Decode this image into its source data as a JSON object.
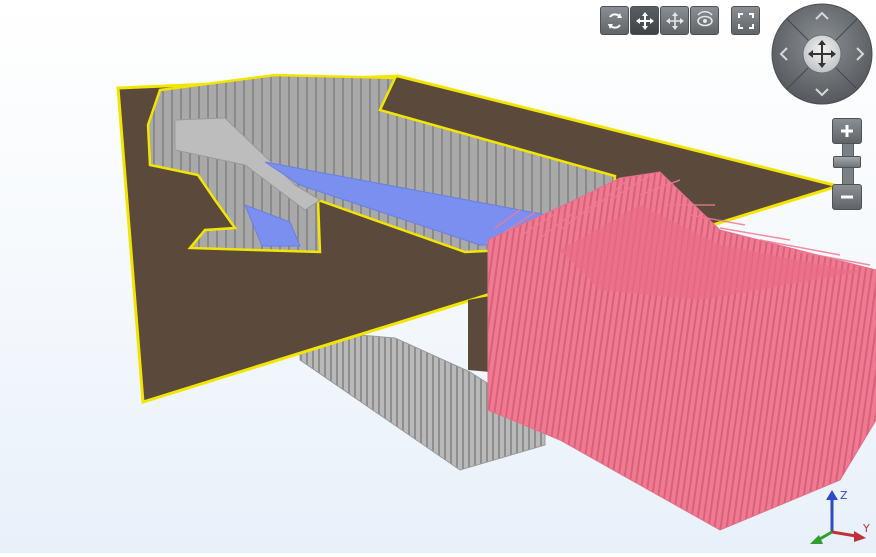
{
  "toolbar": {
    "buttons": [
      {
        "icon": "orbit-icon",
        "state": "inactive"
      },
      {
        "icon": "pan-icon",
        "state": "active"
      },
      {
        "icon": "move-icon",
        "state": "inactive"
      },
      {
        "icon": "look-around-icon",
        "state": "inactive"
      },
      {
        "icon": "fullscreen-icon",
        "state": "inactive"
      }
    ]
  },
  "navigation": {
    "wheel_icon": "navigation-wheel-icon",
    "zoom_in_icon": "plus-icon",
    "zoom_out_icon": "minus-icon"
  },
  "axes": {
    "z_label": "Z",
    "y_label": "Y",
    "x_color": "#2e9e2e",
    "y_color": "#c0303a",
    "z_color": "#2f49c8"
  },
  "model_colors": {
    "ground": "#5b4a3c",
    "outline": "#f2e600",
    "excavation": "#a3a3a3",
    "water": "#7a8ff0",
    "point_cloud": "#f07a92"
  }
}
